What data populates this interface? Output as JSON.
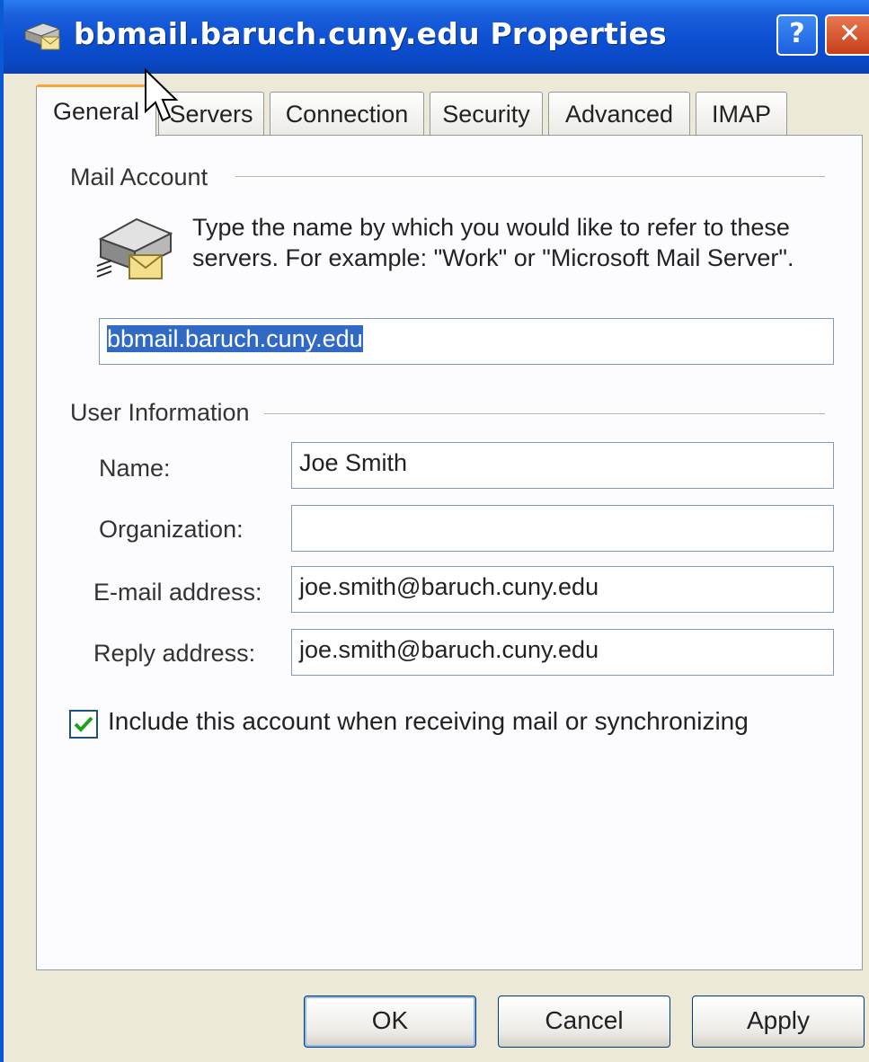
{
  "window": {
    "title": "bbmail.baruch.cuny.edu Properties",
    "help_glyph": "?",
    "close_glyph": "✕"
  },
  "tabs": [
    {
      "label": "General",
      "active": true
    },
    {
      "label": "Servers"
    },
    {
      "label": "Connection"
    },
    {
      "label": "Security"
    },
    {
      "label": "Advanced"
    },
    {
      "label": "IMAP"
    }
  ],
  "mail_account": {
    "group_label": "Mail Account",
    "description": "Type the name by which you would like to refer to these servers.  For example: \"Work\" or \"Microsoft Mail Server\".",
    "account_name_value": "bbmail.baruch.cuny.edu"
  },
  "user_information": {
    "group_label": "User Information",
    "name_label": "Name:",
    "name_value": "Joe Smith",
    "organization_label": "Organization:",
    "organization_value": "",
    "email_label": "E-mail address:",
    "email_value": "joe.smith@baruch.cuny.edu",
    "reply_label": "Reply address:",
    "reply_value": "joe.smith@baruch.cuny.edu"
  },
  "include_account": {
    "label": "Include this account when receiving mail or synchronizing",
    "checked": true
  },
  "buttons": {
    "ok": "OK",
    "cancel": "Cancel",
    "apply": "Apply"
  },
  "icons": {
    "title_icon": "mail-server-icon",
    "account_icon": "mail-server-icon",
    "cursor": "mouse-cursor-icon"
  },
  "colors": {
    "titlebar": "#0c4fd1",
    "selection": "#316ac5",
    "active_tab_accent": "#f7a633",
    "close_button": "#c6401a"
  }
}
